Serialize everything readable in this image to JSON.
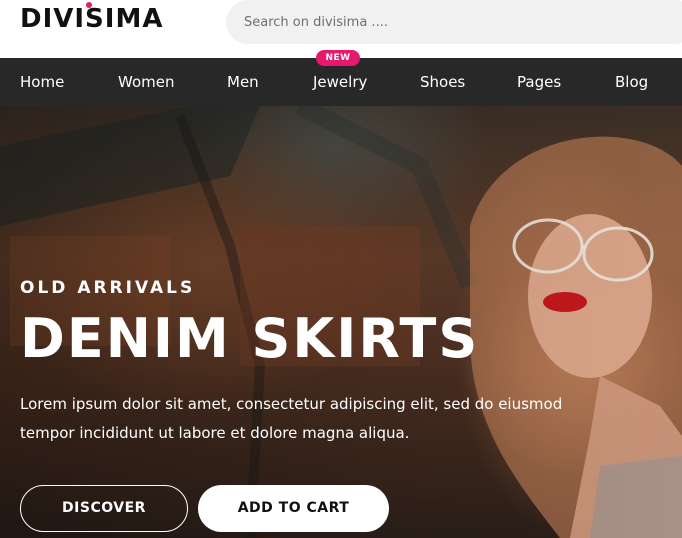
{
  "brand": {
    "logo_text": "DIVISIMA",
    "accent_color": "#e6196e"
  },
  "search": {
    "placeholder": "Search on divisima ...."
  },
  "nav": {
    "items": [
      {
        "label": "Home"
      },
      {
        "label": "Women"
      },
      {
        "label": "Men"
      },
      {
        "label": "Jewelry",
        "badge": "NEW"
      },
      {
        "label": "Shoes"
      },
      {
        "label": "Pages"
      },
      {
        "label": "Blog"
      }
    ],
    "background": "#282828"
  },
  "hero": {
    "eyebrow": "OLD ARRIVALS",
    "headline": "DENIM SKIRTS",
    "description_line1": "Lorem ipsum dolor sit amet, consectetur adipiscing elit, sed do eiusmod",
    "description_line2": "tempor incididunt ut labore et dolore magna aliqua.",
    "discover_label": "DISCOVER",
    "cart_label": "ADD TO CART"
  }
}
